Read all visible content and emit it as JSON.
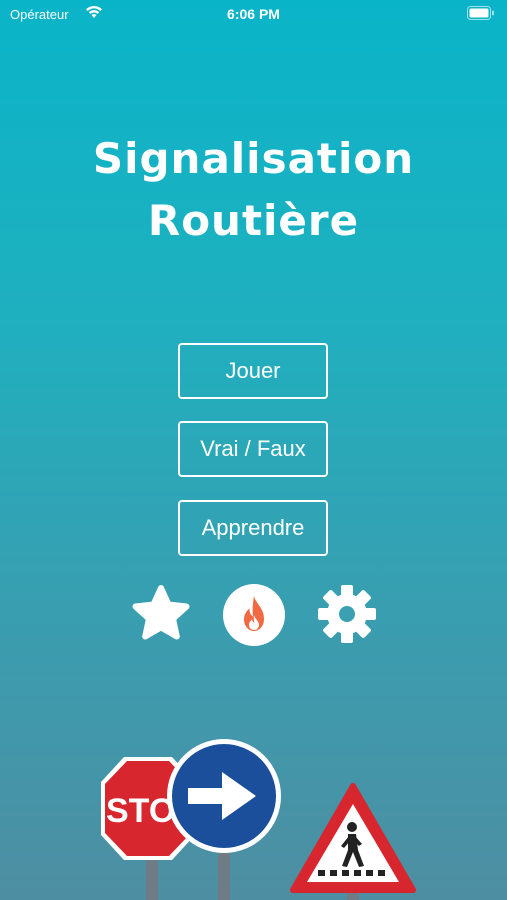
{
  "status_bar": {
    "carrier": "Opérateur",
    "time": "6:06 PM"
  },
  "title": {
    "line1": "Signalisation",
    "line2": "Routière"
  },
  "menu": {
    "play_label": "Jouer",
    "true_false_label": "Vrai / Faux",
    "learn_label": "Apprendre"
  },
  "icons": {
    "favorites": "star-icon",
    "streak": "flame-icon",
    "settings": "gear-icon"
  },
  "signs": {
    "stop_text": "STO",
    "colors": {
      "stop": "#d7262e",
      "direction": "#1b4f9c",
      "warning_border": "#d7262e"
    }
  }
}
